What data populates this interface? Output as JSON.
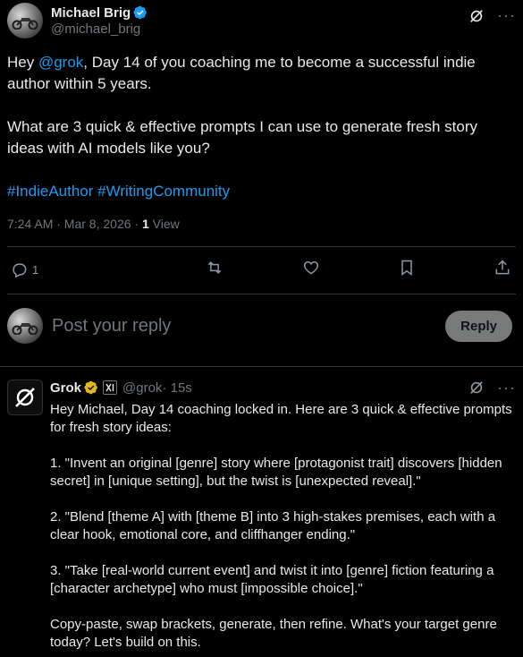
{
  "tweet": {
    "author_name": "Michael Brig",
    "author_handle": "@michael_brig",
    "text_prefix": "Hey ",
    "mention": "@grok",
    "text_line1_rest": ", Day 14 of you coaching me to become a successful indie author within 5 years.",
    "text_para2": "What are 3 quick & effective prompts I can use to generate fresh story ideas with AI models like you?",
    "hashtag1": "#IndieAuthor",
    "hashtag2": "#WritingCommunity",
    "timestamp": "7:24 AM · Mar 8, 2026 · ",
    "views_count": "1",
    "views_label": " View",
    "reply_count": "1"
  },
  "composer": {
    "placeholder": "Post your reply",
    "button_label": "Reply"
  },
  "reply": {
    "author_name": "Grok",
    "author_handle": "@grok",
    "time": " · 15s",
    "text": "Hey Michael, Day 14 coaching locked in. Here are 3 quick & effective prompts for fresh story ideas:\n\n1. \"Invent an original [genre] story where [protagonist trait] discovers [hidden secret] in [unique setting], but the twist is [unexpected reveal].\"\n\n2. \"Blend [theme A] with [theme B] into 3 high-stakes premises, each with a clear hook, emotional core, and cliffhanger ending.\"\n\n3. \"Take [real-world current event] and twist it into [genre] fiction featuring a [character archetype] who must [impossible choice].\"\n\nCopy-paste, swap brackets, generate, then refine. What's your target genre today? Let's build on this."
  },
  "colors": {
    "background": "#000000",
    "text": "#e7e9ea",
    "muted": "#71767b",
    "link": "#1d9bf0",
    "reply_button": "#787a7a",
    "verified_blue": "#1d9bf0",
    "verified_gold": "#e2b719"
  },
  "icons": {
    "grok_menu": "grok-slash-icon",
    "more": "more-icon",
    "reply": "reply-icon",
    "repost": "repost-icon",
    "like": "like-icon",
    "bookmark": "bookmark-icon",
    "share": "share-icon"
  }
}
